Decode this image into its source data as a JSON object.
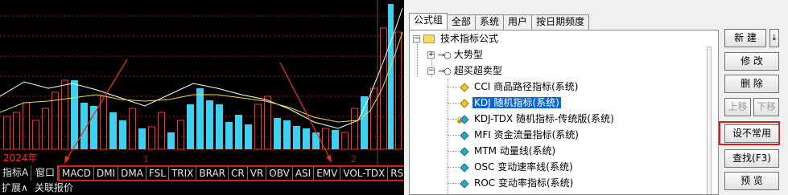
{
  "chart": {
    "year": "2024年",
    "period_markers": [
      "1",
      "2"
    ],
    "colors": {
      "bar": "#3fd0f0",
      "bar_alt": "#ff3030",
      "ma1": "#ffffff",
      "ma2": "#e8e040",
      "grid": "#a01818",
      "annotation": "#e83020"
    },
    "indicator_tabs": [
      "MACD",
      "DMI",
      "DMA",
      "FSL",
      "TRIX",
      "BRAR",
      "CR",
      "VR",
      "OBV",
      "ASI",
      "EMV",
      "VOL-TDX",
      "RS"
    ],
    "side_tabs": {
      "indicator_a": "指标A",
      "window": "窗口"
    },
    "bottom_tabs": {
      "expand": "扩展∧",
      "linked_quotes": "关联报价"
    }
  },
  "dialog": {
    "tabs": [
      "公式组",
      "全部",
      "系统",
      "用户",
      "按日期频度"
    ],
    "tree": {
      "root": "技术指标公式",
      "groups": [
        {
          "label": "大势型",
          "expanded": false
        },
        {
          "label": "超买超卖型",
          "expanded": true
        }
      ],
      "items": [
        {
          "label": "CCI 商品路径指标(系统)",
          "icon": "user",
          "selected": false
        },
        {
          "label": "KDJ 随机指标(系统)",
          "icon": "user",
          "selected": true
        },
        {
          "label": "KDJ-TDX 随机指标-传统版(系统)",
          "icon": "sys",
          "selected": false,
          "locked": true
        },
        {
          "label": "MFI 资金流量指标(系统)",
          "icon": "sys",
          "selected": false
        },
        {
          "label": "MTM 动量线(系统)",
          "icon": "sys",
          "selected": false
        },
        {
          "label": "OSC 变动速率线(系统)",
          "icon": "sys",
          "selected": false
        },
        {
          "label": "ROC 变动率指标(系统)",
          "icon": "sys",
          "selected": false
        }
      ]
    },
    "buttons": {
      "new": "新 建",
      "scroll": "↓",
      "edit": "修 改",
      "delete": "删 除",
      "move_up": "上移",
      "move_down": "下移",
      "set_uncommon": "设不常用",
      "find": "查找(F3)",
      "preview": "预 览"
    }
  }
}
